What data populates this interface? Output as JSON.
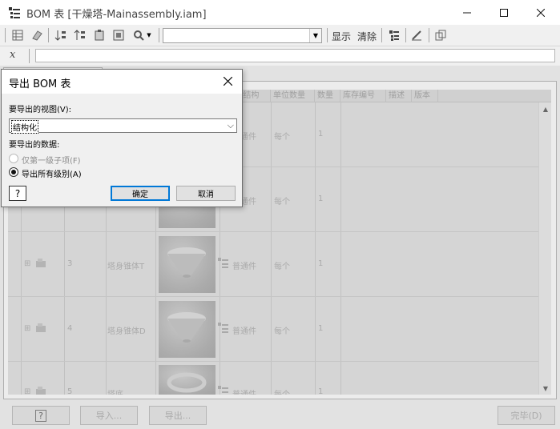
{
  "window": {
    "title": "BOM 表 [干燥塔-Mainassembly.iam]",
    "minimize_icon": "minimize-icon",
    "maximize_icon": "maximize-icon",
    "close_icon": "close-icon"
  },
  "toolbar": {
    "combo_value": "",
    "show_label": "显示",
    "clear_label": "清除"
  },
  "formula": {
    "symbol": "x",
    "value": ""
  },
  "grid": {
    "columns": [
      "",
      "",
      "",
      "",
      "",
      "BOM 结构",
      "单位数量",
      "数量",
      "库存编号",
      "描述",
      "版本"
    ],
    "rows": [
      {
        "item": "",
        "part": "",
        "structure": "普通件",
        "unit_qty": "每个",
        "qty": "1"
      },
      {
        "item": "",
        "part": "",
        "structure": "普通件",
        "unit_qty": "每个",
        "qty": "1"
      },
      {
        "item": "3",
        "part": "塔身锥体T",
        "structure": "普通件",
        "unit_qty": "每个",
        "qty": "1"
      },
      {
        "item": "4",
        "part": "塔身锥体D",
        "structure": "普通件",
        "unit_qty": "每个",
        "qty": "1"
      },
      {
        "item": "5",
        "part": "塔底",
        "structure": "普通件",
        "unit_qty": "每个",
        "qty": "1"
      }
    ]
  },
  "bottom": {
    "help_symbol": "?",
    "import_label": "导入...",
    "export_label": "导出...",
    "done_label": "完毕(D)"
  },
  "dialog": {
    "title": "导出 BOM 表",
    "view_label": "要导出的视图(V):",
    "view_value": "结构化",
    "data_label": "要导出的数据:",
    "option_first_level": "仅第一级子项(F)",
    "option_all_levels": "导出所有级别(A)",
    "selected_option": "all_levels",
    "help_symbol": "?",
    "ok_label": "确定",
    "cancel_label": "取消"
  }
}
